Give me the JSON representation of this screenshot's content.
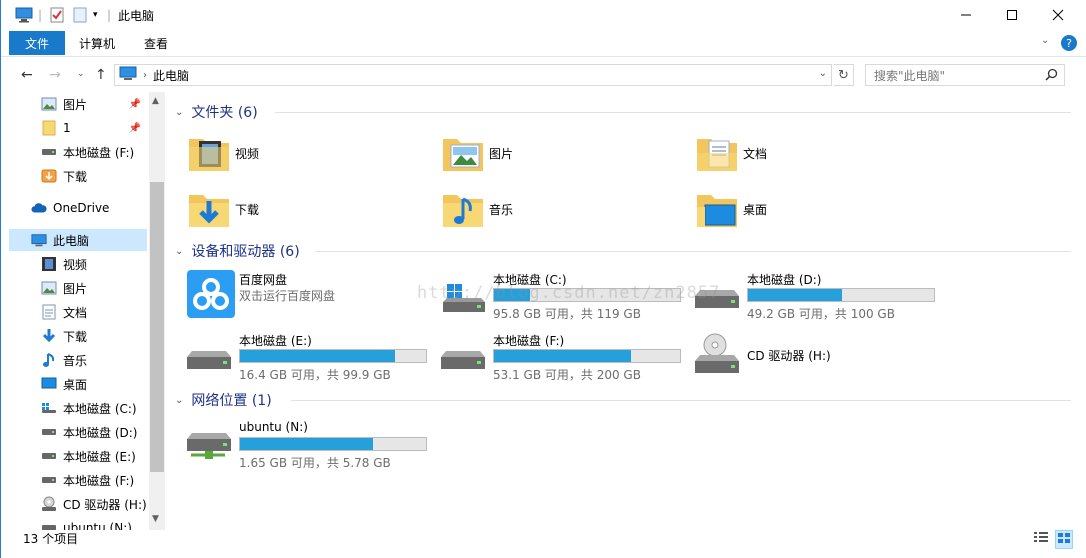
{
  "window": {
    "title": "此电脑",
    "minimize_icon": "minimize-icon",
    "maximize_icon": "maximize-icon",
    "close_icon": "close-icon"
  },
  "ribbon": {
    "tabs": [
      {
        "label": "文件"
      },
      {
        "label": "计算机"
      },
      {
        "label": "查看"
      }
    ]
  },
  "address": {
    "crumb": "此电脑",
    "search_placeholder": "搜索\"此电脑\""
  },
  "sidebar": {
    "items": [
      {
        "label": "图片",
        "icon": "pictures-icon",
        "pinned": true
      },
      {
        "label": "1",
        "icon": "folder-icon",
        "pinned": true
      },
      {
        "label": "本地磁盘 (F:)",
        "icon": "drive-icon"
      },
      {
        "label": "下载",
        "icon": "download-icon"
      },
      {
        "label": "OneDrive",
        "icon": "cloud-icon"
      },
      {
        "label": "此电脑",
        "icon": "computer-icon",
        "selected": true
      },
      {
        "label": "视频",
        "icon": "video-icon"
      },
      {
        "label": "图片",
        "icon": "pictures-icon"
      },
      {
        "label": "文档",
        "icon": "documents-icon"
      },
      {
        "label": "下载",
        "icon": "download-icon"
      },
      {
        "label": "音乐",
        "icon": "music-icon"
      },
      {
        "label": "桌面",
        "icon": "desktop-icon"
      },
      {
        "label": "本地磁盘 (C:)",
        "icon": "windows-drive-icon"
      },
      {
        "label": "本地磁盘 (D:)",
        "icon": "drive-icon"
      },
      {
        "label": "本地磁盘 (E:)",
        "icon": "drive-icon"
      },
      {
        "label": "本地磁盘 (F:)",
        "icon": "drive-icon"
      },
      {
        "label": "CD 驱动器 (H:)",
        "icon": "cd-drive-icon"
      },
      {
        "label": "ubuntu (N:)",
        "icon": "network-drive-icon"
      }
    ]
  },
  "groups": {
    "folders": {
      "title": "文件夹 (6)",
      "items": [
        {
          "label": "视频",
          "icon": "video-folder-icon"
        },
        {
          "label": "图片",
          "icon": "pictures-folder-icon"
        },
        {
          "label": "文档",
          "icon": "documents-folder-icon"
        },
        {
          "label": "下载",
          "icon": "download-folder-icon"
        },
        {
          "label": "音乐",
          "icon": "music-folder-icon"
        },
        {
          "label": "桌面",
          "icon": "desktop-folder-icon"
        }
      ]
    },
    "devices": {
      "title": "设备和驱动器 (6)",
      "baidu": {
        "name": "百度网盘",
        "subtitle": "双击运行百度网盘"
      },
      "drives": [
        {
          "name": "本地磁盘 (C:)",
          "info": "95.8 GB 可用，共 119 GB",
          "used_fraction": 0.195
        },
        {
          "name": "本地磁盘 (D:)",
          "info": "49.2 GB 可用，共 100 GB",
          "used_fraction": 0.508
        },
        {
          "name": "本地磁盘 (E:)",
          "info": "16.4 GB 可用，共 99.9 GB",
          "used_fraction": 0.836
        },
        {
          "name": "本地磁盘 (F:)",
          "info": "53.1 GB 可用，共 200 GB",
          "used_fraction": 0.7345
        },
        {
          "name": "CD 驱动器 (H:)"
        }
      ]
    },
    "network": {
      "title": "网络位置 (1)",
      "drives": [
        {
          "name": "ubuntu (N:)",
          "info": "1.65 GB 可用，共 5.78 GB",
          "used_fraction": 0.715
        }
      ]
    }
  },
  "status": {
    "count": "13 个项目"
  },
  "watermark": "http://blog.csdn.net/zn2857",
  "colors": {
    "accent": "#1979ca",
    "drive_fill": "#26a0da",
    "group_header": "#1e3287",
    "selection": "#cce8ff"
  }
}
